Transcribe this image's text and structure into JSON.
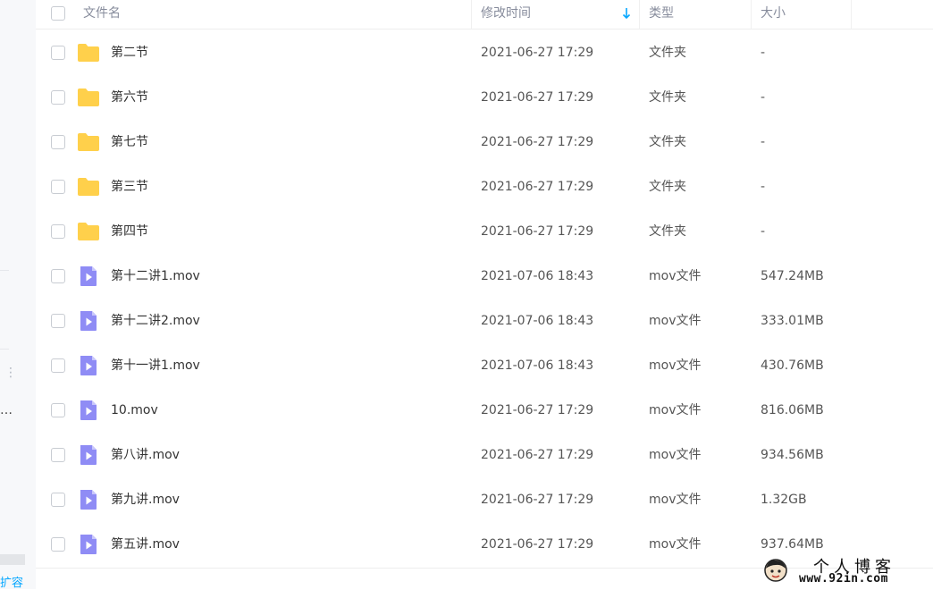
{
  "sidebar": {
    "truncated_text": "…",
    "expand_link": "扩容"
  },
  "header": {
    "name_col": "文件名",
    "time_col": "修改时间",
    "type_col": "类型",
    "size_col": "大小",
    "sort_icon": "arrow-down-icon"
  },
  "files": [
    {
      "name": "第二节",
      "modified": "2021-06-27 17:29",
      "type": "文件夹",
      "size": "-",
      "icon": "folder-icon"
    },
    {
      "name": "第六节",
      "modified": "2021-06-27 17:29",
      "type": "文件夹",
      "size": "-",
      "icon": "folder-icon"
    },
    {
      "name": "第七节",
      "modified": "2021-06-27 17:29",
      "type": "文件夹",
      "size": "-",
      "icon": "folder-icon"
    },
    {
      "name": "第三节",
      "modified": "2021-06-27 17:29",
      "type": "文件夹",
      "size": "-",
      "icon": "folder-icon"
    },
    {
      "name": "第四节",
      "modified": "2021-06-27 17:29",
      "type": "文件夹",
      "size": "-",
      "icon": "folder-icon"
    },
    {
      "name": "第十二讲1.mov",
      "modified": "2021-07-06 18:43",
      "type": "mov文件",
      "size": "547.24MB",
      "icon": "video-file-icon"
    },
    {
      "name": "第十二讲2.mov",
      "modified": "2021-07-06 18:43",
      "type": "mov文件",
      "size": "333.01MB",
      "icon": "video-file-icon"
    },
    {
      "name": "第十一讲1.mov",
      "modified": "2021-07-06 18:43",
      "type": "mov文件",
      "size": "430.76MB",
      "icon": "video-file-icon"
    },
    {
      "name": "10.mov",
      "modified": "2021-06-27 17:29",
      "type": "mov文件",
      "size": "816.06MB",
      "icon": "video-file-icon"
    },
    {
      "name": "第八讲.mov",
      "modified": "2021-06-27 17:29",
      "type": "mov文件",
      "size": "934.56MB",
      "icon": "video-file-icon"
    },
    {
      "name": "第九讲.mov",
      "modified": "2021-06-27 17:29",
      "type": "mov文件",
      "size": "1.32GB",
      "icon": "video-file-icon"
    },
    {
      "name": "第五讲.mov",
      "modified": "2021-06-27 17:29",
      "type": "mov文件",
      "size": "937.64MB",
      "icon": "video-file-icon"
    }
  ],
  "watermark": {
    "title": "个人博客",
    "url": "www.92in.com"
  },
  "colors": {
    "folder": "#ffd04b",
    "video_file": "#8f8cf5",
    "accent": "#06a7ff"
  }
}
